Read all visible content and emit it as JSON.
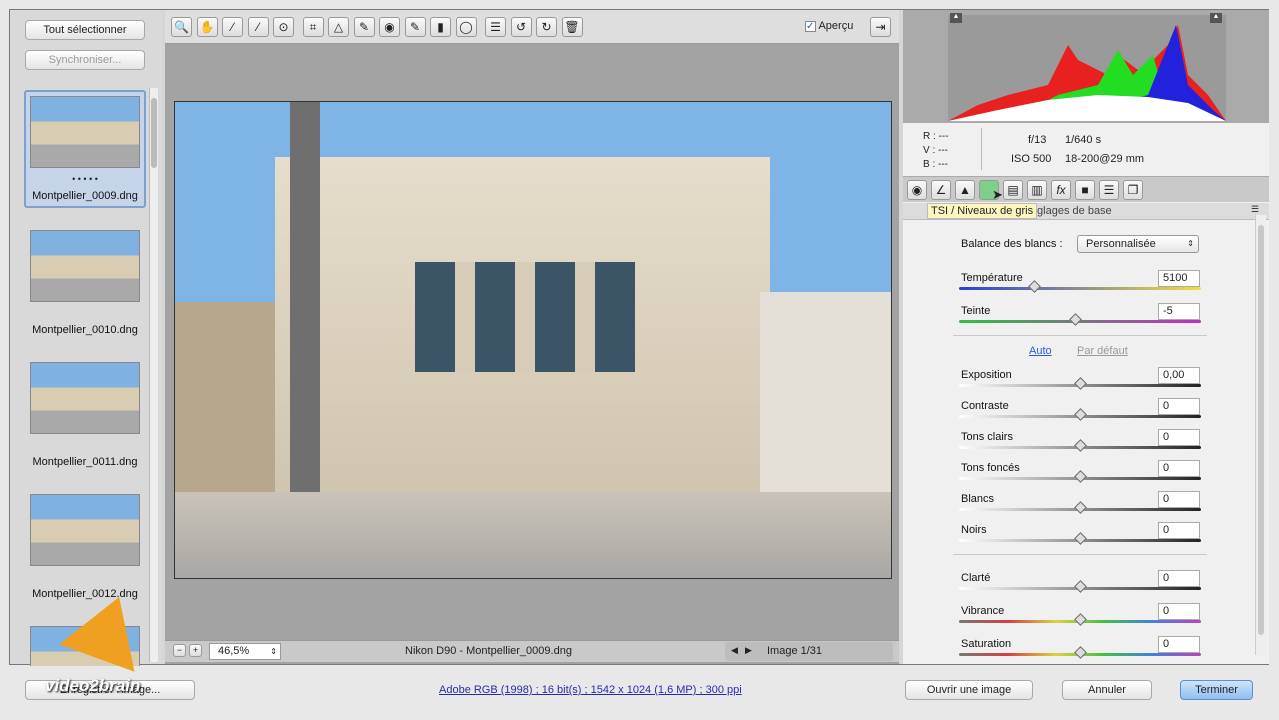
{
  "filmstrip": {
    "select_all": "Tout sélectionner",
    "sync": "Synchroniser...",
    "items": [
      {
        "name": "Montpellier_0009.dng",
        "rating": "• • • • •"
      },
      {
        "name": "Montpellier_0010.dng"
      },
      {
        "name": "Montpellier_0011.dng"
      },
      {
        "name": "Montpellier_0012.dng"
      },
      {
        "name": ""
      }
    ]
  },
  "toolbar": {
    "preview_label": "Aperçu",
    "preview_checked": true,
    "tools": [
      "zoom-icon",
      "hand-icon",
      "white-balance-icon",
      "color-sampler-icon",
      "target-adjust-icon",
      "crop-icon",
      "straighten-icon",
      "spot-removal-icon",
      "red-eye-icon",
      "brush-icon",
      "graduated-filter-icon",
      "radial-filter-icon",
      "list-icon",
      "rotate-left-icon",
      "rotate-right-icon",
      "trash-icon"
    ]
  },
  "status": {
    "zoom": "46,5%",
    "file": "Nikon D90  -  Montpellier_0009.dng",
    "image_count": "Image 1/31"
  },
  "info": {
    "r": "R :  ---",
    "v": "V :  ---",
    "b": "B :  ---",
    "aperture": "f/13",
    "shutter": "1/640 s",
    "iso": "ISO 500",
    "lens": "18-200@29 mm"
  },
  "panel": {
    "tooltip": "TSI / Niveaux de gris",
    "title": "Réglages de base",
    "wb_label": "Balance des blancs :",
    "wb_value": "Personnalisée",
    "auto": "Auto",
    "default": "Par défaut",
    "sliders": [
      {
        "label": "Température",
        "value": "5100",
        "pos": 0.31
      },
      {
        "label": "Teinte",
        "value": "-5",
        "pos": 0.48
      },
      {
        "label": "Exposition",
        "value": "0,00",
        "pos": 0.5
      },
      {
        "label": "Contraste",
        "value": "0",
        "pos": 0.5
      },
      {
        "label": "Tons clairs",
        "value": "0",
        "pos": 0.5
      },
      {
        "label": "Tons foncés",
        "value": "0",
        "pos": 0.5
      },
      {
        "label": "Blancs",
        "value": "0",
        "pos": 0.5
      },
      {
        "label": "Noirs",
        "value": "0",
        "pos": 0.5
      },
      {
        "label": "Clarté",
        "value": "0",
        "pos": 0.5
      },
      {
        "label": "Vibrance",
        "value": "0",
        "pos": 0.5
      },
      {
        "label": "Saturation",
        "value": "0",
        "pos": 0.5
      }
    ]
  },
  "footer": {
    "save": "Enregistrer l'image...",
    "workflow": "Adobe RGB (1998) ; 16 bit(s) ; 1542 x 1024 (1,6 MP) ; 300 ppi",
    "open": "Ouvrir une image",
    "cancel": "Annuler",
    "done": "Terminer",
    "watermark": "video2brain"
  }
}
